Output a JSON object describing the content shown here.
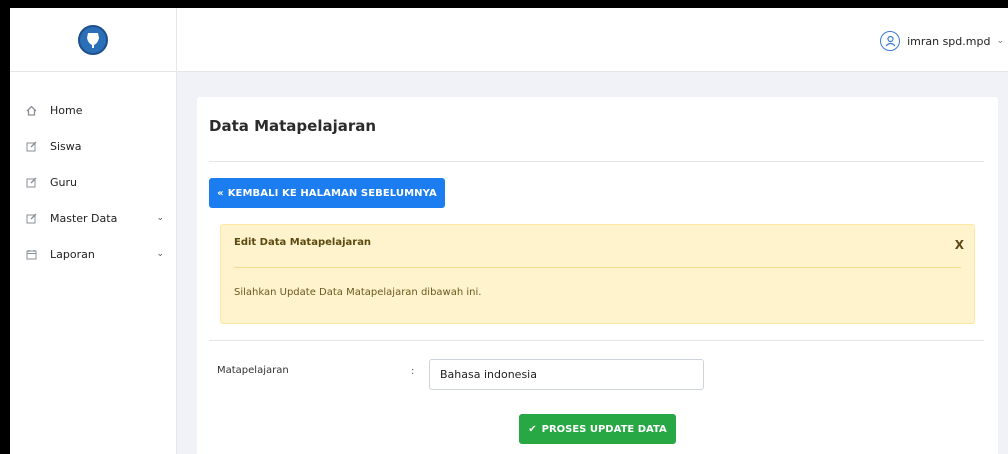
{
  "sidebar": {
    "items": [
      {
        "label": "Home",
        "icon": "home-icon"
      },
      {
        "label": "Siswa",
        "icon": "edit-icon"
      },
      {
        "label": "Guru",
        "icon": "edit-icon"
      },
      {
        "label": "Master Data",
        "icon": "edit-icon",
        "has_submenu": true
      },
      {
        "label": "Laporan",
        "icon": "calendar-icon",
        "has_submenu": true
      }
    ]
  },
  "header": {
    "user_name": "imran spd.mpd",
    "user_icon": "user-icon"
  },
  "main": {
    "title": "Data Matapelajaran",
    "back_button": "KEMBALI KE HALAMAN SEBELUMNYA",
    "alert": {
      "title": "Edit Data Matapelajaran",
      "close": "X",
      "message": "Silahkan Update Data Matapelajaran dibawah ini."
    },
    "form": {
      "label": "Matapelajaran",
      "colon": ":",
      "value": "Bahasa indonesia"
    },
    "submit_button": "PROSES UPDATE DATA"
  },
  "colors": {
    "primary": "#1b7df0",
    "success": "#28a745",
    "warning_bg": "#fff3cd"
  }
}
